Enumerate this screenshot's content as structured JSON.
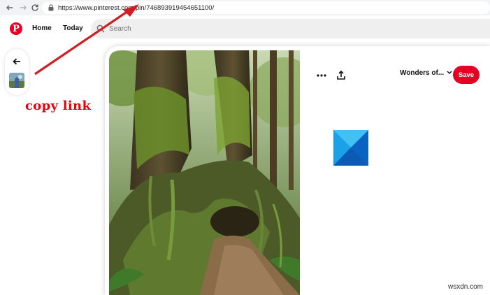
{
  "browser": {
    "url": "https://www.pinterest.com/pin/746893919454651100/",
    "back_icon": "arrow-left-icon",
    "forward_icon": "arrow-right-icon",
    "reload_icon": "reload-icon"
  },
  "header": {
    "logo": "P",
    "nav": {
      "home": "Home",
      "today": "Today"
    },
    "search_placeholder": "Search"
  },
  "annotation": {
    "text": "copy link",
    "color": "#e60012"
  },
  "pin": {
    "board": "Wonders of...",
    "save_label": "Save",
    "more_label": "•••"
  },
  "colors": {
    "brand": "#e60023"
  },
  "watermark": "wsxdn.com"
}
